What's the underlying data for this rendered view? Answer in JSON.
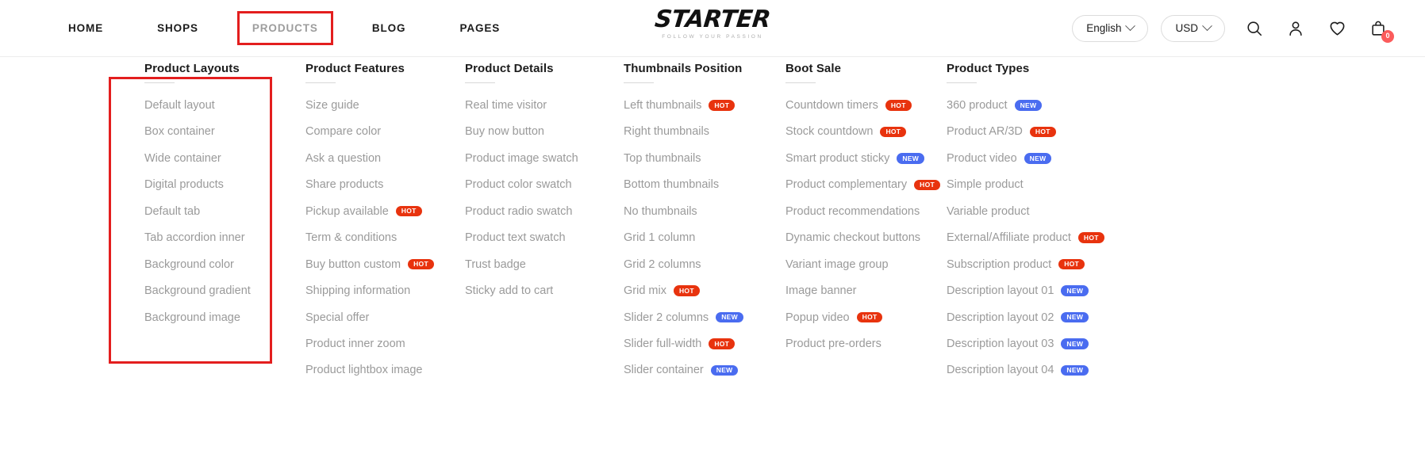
{
  "header": {
    "nav": [
      {
        "label": "HOME",
        "state": "default"
      },
      {
        "label": "SHOPS",
        "state": "default"
      },
      {
        "label": "PRODUCTS",
        "state": "active"
      },
      {
        "label": "BLOG",
        "state": "default"
      },
      {
        "label": "PAGES",
        "state": "default"
      }
    ],
    "logo": {
      "name": "STARTER",
      "tagline": "FOLLOW YOUR PASSION"
    },
    "language": {
      "value": "English",
      "icon": "chevron-down-icon"
    },
    "currency": {
      "value": "USD",
      "icon": "chevron-down-icon"
    },
    "icons": {
      "search": "search-icon",
      "account": "user-icon",
      "wishlist": "heart-icon",
      "cart": "cart-bag-icon"
    },
    "cart_count": "0"
  },
  "colors": {
    "hot_badge": "#e8330e",
    "new_badge": "#4a6cf0",
    "highlight_box": "#e31e1e",
    "cart_badge": "#fb5b5b",
    "link_text": "#9a9a9a",
    "heading_text": "#1c1c1c"
  },
  "mega_menu": {
    "columns": [
      {
        "title": "Product Layouts",
        "highlighted": true,
        "items": [
          {
            "label": "Default layout",
            "badge": null
          },
          {
            "label": "Box container",
            "badge": null
          },
          {
            "label": "Wide container",
            "badge": null
          },
          {
            "label": "Digital products",
            "badge": null
          },
          {
            "label": "Default tab",
            "badge": null
          },
          {
            "label": "Tab accordion inner",
            "badge": null
          },
          {
            "label": "Background color",
            "badge": null
          },
          {
            "label": "Background gradient",
            "badge": null
          },
          {
            "label": "Background image",
            "badge": null
          }
        ]
      },
      {
        "title": "Product Features",
        "highlighted": false,
        "items": [
          {
            "label": "Size guide",
            "badge": null
          },
          {
            "label": "Compare color",
            "badge": null
          },
          {
            "label": "Ask a question",
            "badge": null
          },
          {
            "label": "Share products",
            "badge": null
          },
          {
            "label": "Pickup available",
            "badge": "HOT"
          },
          {
            "label": "Term & conditions",
            "badge": null
          },
          {
            "label": "Buy button custom",
            "badge": "HOT"
          },
          {
            "label": "Shipping information",
            "badge": null
          },
          {
            "label": "Special offer",
            "badge": null
          },
          {
            "label": "Product inner zoom",
            "badge": null
          },
          {
            "label": "Product lightbox image",
            "badge": null
          }
        ]
      },
      {
        "title": "Product Details",
        "highlighted": false,
        "items": [
          {
            "label": "Real time visitor",
            "badge": null
          },
          {
            "label": "Buy now button",
            "badge": null
          },
          {
            "label": "Product image swatch",
            "badge": null
          },
          {
            "label": "Product color swatch",
            "badge": null
          },
          {
            "label": "Product radio swatch",
            "badge": null
          },
          {
            "label": "Product text swatch",
            "badge": null
          },
          {
            "label": "Trust badge",
            "badge": null
          },
          {
            "label": "Sticky add to cart",
            "badge": null
          }
        ]
      },
      {
        "title": "Thumbnails Position",
        "highlighted": false,
        "items": [
          {
            "label": "Left thumbnails",
            "badge": "HOT"
          },
          {
            "label": "Right thumbnails",
            "badge": null
          },
          {
            "label": "Top thumbnails",
            "badge": null
          },
          {
            "label": "Bottom thumbnails",
            "badge": null
          },
          {
            "label": "No thumbnails",
            "badge": null
          },
          {
            "label": "Grid 1 column",
            "badge": null
          },
          {
            "label": "Grid 2 columns",
            "badge": null
          },
          {
            "label": "Grid mix",
            "badge": "HOT"
          },
          {
            "label": "Slider 2 columns",
            "badge": "NEW"
          },
          {
            "label": "Slider full-width",
            "badge": "HOT"
          },
          {
            "label": "Slider container",
            "badge": "NEW"
          }
        ]
      },
      {
        "title": "Boot Sale",
        "highlighted": false,
        "items": [
          {
            "label": "Countdown timers",
            "badge": "HOT"
          },
          {
            "label": "Stock countdown",
            "badge": "HOT"
          },
          {
            "label": "Smart product sticky",
            "badge": "NEW"
          },
          {
            "label": "Product complementary",
            "badge": "HOT"
          },
          {
            "label": "Product recommendations",
            "badge": null
          },
          {
            "label": "Dynamic checkout buttons",
            "badge": null
          },
          {
            "label": "Variant image group",
            "badge": null
          },
          {
            "label": "Image banner",
            "badge": null
          },
          {
            "label": "Popup video",
            "badge": "HOT"
          },
          {
            "label": "Product pre-orders",
            "badge": null
          }
        ]
      },
      {
        "title": "Product Types",
        "highlighted": false,
        "items": [
          {
            "label": "360 product",
            "badge": "NEW"
          },
          {
            "label": "Product AR/3D",
            "badge": "HOT"
          },
          {
            "label": "Product video",
            "badge": "NEW"
          },
          {
            "label": "Simple product",
            "badge": null
          },
          {
            "label": "Variable product",
            "badge": null
          },
          {
            "label": "External/Affiliate product",
            "badge": "HOT"
          },
          {
            "label": "Subscription product",
            "badge": "HOT"
          },
          {
            "label": "Description layout 01",
            "badge": "NEW"
          },
          {
            "label": "Description layout 02",
            "badge": "NEW"
          },
          {
            "label": "Description layout 03",
            "badge": "NEW"
          },
          {
            "label": "Description layout 04",
            "badge": "NEW"
          }
        ]
      }
    ]
  }
}
